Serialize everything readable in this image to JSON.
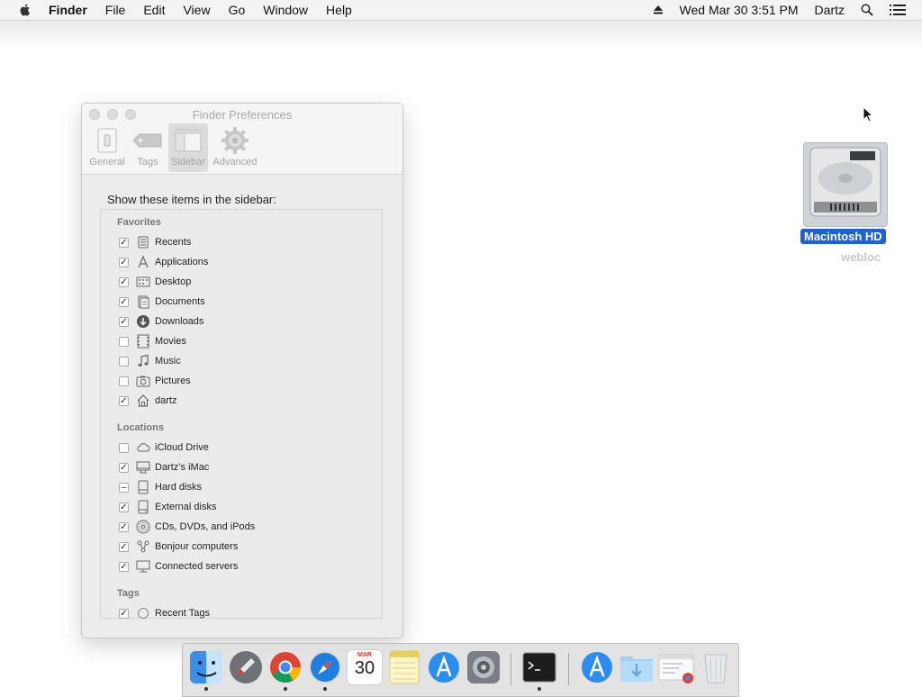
{
  "menubar": {
    "app_name": "Finder",
    "menus": [
      "File",
      "Edit",
      "View",
      "Go",
      "Window",
      "Help"
    ],
    "clock": "Wed Mar 30  3:51 PM",
    "user": "Dartz"
  },
  "window": {
    "title": "Finder Preferences",
    "tabs": [
      {
        "label": "General",
        "icon": "switch-icon"
      },
      {
        "label": "Tags",
        "icon": "tag-icon"
      },
      {
        "label": "Sidebar",
        "icon": "sidebar-icon",
        "active": true
      },
      {
        "label": "Advanced",
        "icon": "gear-icon"
      }
    ],
    "heading": "Show these items in the sidebar:",
    "sections": [
      {
        "title": "Favorites",
        "items": [
          {
            "label": "Recents",
            "state": "checked",
            "icon": "recents-icon"
          },
          {
            "label": "Applications",
            "state": "checked",
            "icon": "applications-icon"
          },
          {
            "label": "Desktop",
            "state": "checked",
            "icon": "desktop-icon"
          },
          {
            "label": "Documents",
            "state": "checked",
            "icon": "documents-icon"
          },
          {
            "label": "Downloads",
            "state": "checked",
            "icon": "downloads-icon"
          },
          {
            "label": "Movies",
            "state": "unchecked",
            "icon": "movies-icon"
          },
          {
            "label": "Music",
            "state": "unchecked",
            "icon": "music-icon"
          },
          {
            "label": "Pictures",
            "state": "unchecked",
            "icon": "pictures-icon"
          },
          {
            "label": "dartz",
            "state": "checked",
            "icon": "home-icon"
          }
        ]
      },
      {
        "title": "Locations",
        "items": [
          {
            "label": "iCloud Drive",
            "state": "unchecked",
            "icon": "cloud-icon"
          },
          {
            "label": "Dartz’s iMac",
            "state": "checked",
            "icon": "imac-icon"
          },
          {
            "label": "Hard disks",
            "state": "mixed",
            "icon": "hard-disk-icon"
          },
          {
            "label": "External disks",
            "state": "checked",
            "icon": "external-disk-icon"
          },
          {
            "label": "CDs, DVDs, and iPods",
            "state": "checked",
            "icon": "cd-icon"
          },
          {
            "label": "Bonjour computers",
            "state": "checked",
            "icon": "bonjour-icon"
          },
          {
            "label": "Connected servers",
            "state": "checked",
            "icon": "server-icon"
          }
        ]
      },
      {
        "title": "Tags",
        "items": [
          {
            "label": "Recent Tags",
            "state": "checked",
            "icon": "tag-circle-icon"
          }
        ]
      }
    ]
  },
  "desktop": {
    "disk_label": "Macintosh HD",
    "overlap_label": "webloc"
  },
  "dock": {
    "apps": [
      {
        "name": "finder-icon",
        "running": true
      },
      {
        "name": "launchpad-icon",
        "running": false
      },
      {
        "name": "chrome-icon",
        "running": true
      },
      {
        "name": "safari-icon",
        "running": true
      },
      {
        "name": "calendar-icon",
        "running": false,
        "month": "MAR",
        "day": "30"
      },
      {
        "name": "notes-icon",
        "running": false
      },
      {
        "name": "app-store-icon",
        "running": false
      },
      {
        "name": "system-preferences-icon",
        "running": false
      },
      {
        "name": "terminal-icon",
        "running": true
      },
      {
        "name": "applications-folder-icon",
        "running": false
      },
      {
        "name": "downloads-folder-icon",
        "running": false
      },
      {
        "name": "webloc-document-icon",
        "running": false
      },
      {
        "name": "trash-icon",
        "running": false
      }
    ]
  },
  "colors": {
    "selection": "#1d62d4",
    "window_bg": "#ececec"
  }
}
